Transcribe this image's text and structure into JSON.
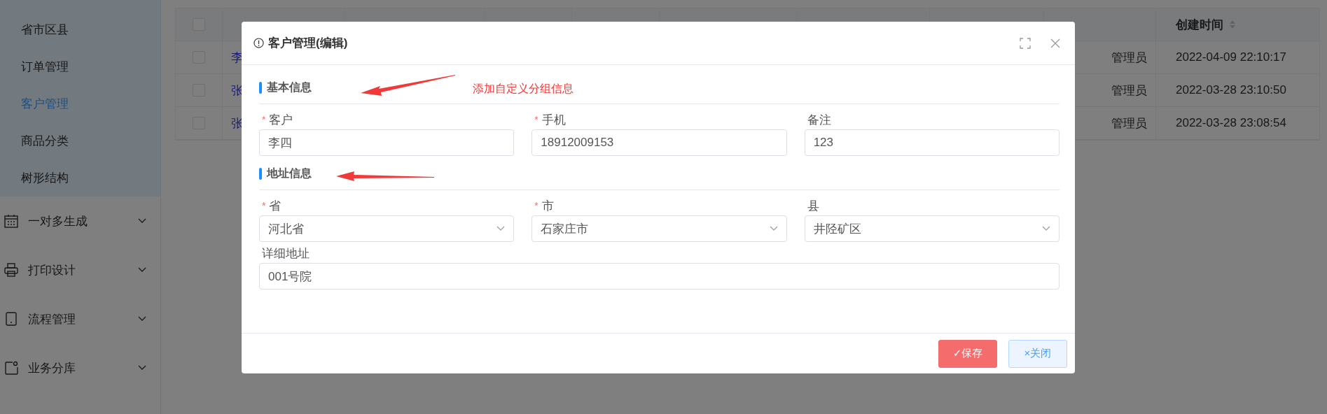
{
  "sidebar": {
    "sub_items": [
      {
        "label": "省市区县",
        "selected": false
      },
      {
        "label": "订单管理",
        "selected": false
      },
      {
        "label": "客户管理",
        "selected": true
      },
      {
        "label": "商品分类",
        "selected": false
      },
      {
        "label": "树形结构",
        "selected": false
      }
    ],
    "menus": [
      {
        "label": "一对多生成",
        "expanded": false
      },
      {
        "label": "打印设计",
        "expanded": false
      },
      {
        "label": "流程管理",
        "expanded": false
      },
      {
        "label": "业务分库",
        "expanded": false
      }
    ]
  },
  "table": {
    "all_checked": false,
    "header": {
      "label": "创建时间",
      "sortable": true
    },
    "rows": [
      {
        "checked": false,
        "customer": "李",
        "creator": "管理员",
        "created": "2022-04-09 22:10:17"
      },
      {
        "checked": false,
        "customer": "张",
        "creator": "管理员",
        "created": "2022-03-28 23:10:50"
      },
      {
        "checked": false,
        "customer": "张",
        "creator": "管理员",
        "created": "2022-03-28 23:08:54"
      }
    ]
  },
  "dialog": {
    "title": "客户管理(编辑)",
    "annotation": "添加自定义分组信息",
    "sections": [
      {
        "title": "基本信息",
        "fields": [
          {
            "label": "客户",
            "required_mark": "*",
            "kind": "input",
            "wide": false,
            "value": "李四"
          },
          {
            "label": "手机",
            "required_mark": "*",
            "kind": "input",
            "wide": false,
            "value": "18912009153"
          },
          {
            "label": "备注",
            "kind": "input",
            "wide": false,
            "value": "123"
          }
        ]
      },
      {
        "title": "地址信息",
        "fields": [
          {
            "label": "省",
            "required_mark": "*",
            "kind": "select",
            "wide": false,
            "value": "河北省"
          },
          {
            "label": "市",
            "required_mark": "*",
            "kind": "select",
            "wide": false,
            "value": "石家庄市"
          },
          {
            "label": "县",
            "kind": "select",
            "wide": false,
            "value": "井陉矿区"
          },
          {
            "label": "详细地址",
            "kind": "input",
            "wide": true,
            "value": "001号院"
          }
        ]
      }
    ],
    "buttons": [
      {
        "label": "✓保存",
        "kind": "primary"
      },
      {
        "label": "×关闭",
        "kind": "plain"
      }
    ]
  }
}
